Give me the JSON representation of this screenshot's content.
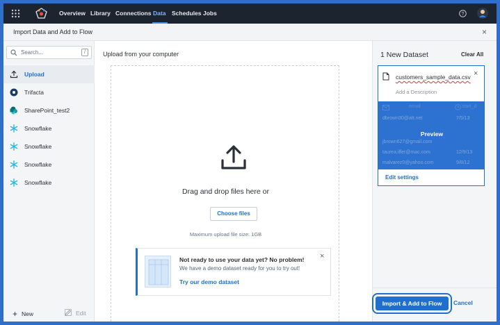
{
  "nav": {
    "items": [
      {
        "label": "Overview",
        "active": false
      },
      {
        "label": "Library",
        "active": false
      },
      {
        "label": "Connections",
        "active": false
      },
      {
        "label": "Data",
        "active": true
      },
      {
        "label": "Schedules",
        "active": false
      },
      {
        "label": "Jobs",
        "active": false
      }
    ]
  },
  "header": {
    "title": "Import Data and Add to Flow",
    "close": "×"
  },
  "sidebar": {
    "search_placeholder": "Search...",
    "search_shortcut": "/",
    "items": [
      {
        "label": "Upload",
        "icon": "upload-icon",
        "active": true
      },
      {
        "label": "Trifacta",
        "icon": "trifacta-icon",
        "active": false
      },
      {
        "label": "SharePoint_test2",
        "icon": "sharepoint-icon",
        "active": false
      },
      {
        "label": "Snowflake",
        "icon": "snowflake-icon",
        "active": false
      },
      {
        "label": "Snowflake",
        "icon": "snowflake-icon",
        "active": false
      },
      {
        "label": "Snowflake",
        "icon": "snowflake-icon",
        "active": false
      },
      {
        "label": "Snowflake",
        "icon": "snowflake-icon",
        "active": false
      }
    ],
    "new_label": "New",
    "edit_label": "Edit"
  },
  "upload": {
    "title": "Upload from your computer",
    "drag_text": "Drag and drop files here or",
    "choose_label": "Choose files",
    "max_size": "Maximum upload file size: 1GB",
    "demo": {
      "title": "Not ready to use your data yet? No problem!",
      "subtitle": "We have a demo dataset ready for you to try out!",
      "link": "Try our demo dataset",
      "close": "×"
    }
  },
  "datasets": {
    "title": "1 New Dataset",
    "clear_all": "Clear All",
    "file": {
      "name": "customers_sample_data.csv",
      "description_placeholder": "Add a Description",
      "close": "×",
      "preview_label": "Preview",
      "preview_columns": [
        "email",
        "start_d"
      ],
      "preview_rows": [
        [
          "dbrown30@att.net",
          "7/5/13"
        ],
        [
          "",
          ""
        ],
        [
          "jbrown627@gmail.com",
          ""
        ],
        [
          "taurea.iffer@mac.com",
          "12/9/13"
        ],
        [
          "malvarez0@yahoo.com",
          "9/8/12"
        ]
      ],
      "edit_settings": "Edit settings"
    }
  },
  "footer": {
    "import_label": "Import & Add to Flow",
    "cancel_label": "Cancel"
  },
  "colors": {
    "accent": "#1f6fd1",
    "nav_bg": "#1c2430",
    "frame": "#2f6fc9"
  }
}
